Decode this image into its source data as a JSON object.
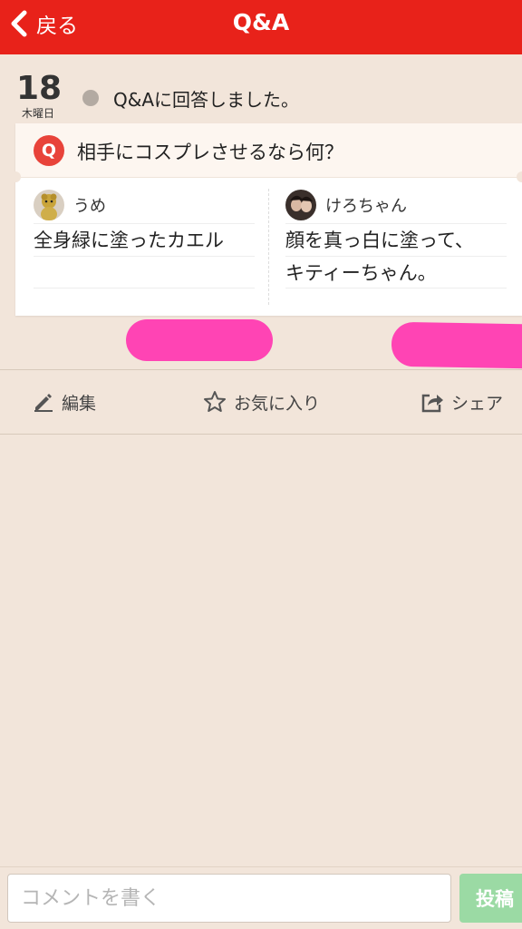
{
  "navbar": {
    "back_label": "戻る",
    "title": "Q&A"
  },
  "entry": {
    "day": "18",
    "weekday": "木曜日",
    "activity": "Q&Aに回答しました。"
  },
  "question": {
    "badge": "Q",
    "text": "相手にコスプレさせるなら何？"
  },
  "answers": [
    {
      "user": "うめ",
      "lines": [
        "全身緑に塗ったカエル",
        ""
      ]
    },
    {
      "user": "けろちゃん",
      "lines": [
        "顔を真っ白に塗って、",
        "キティーちゃん。"
      ]
    }
  ],
  "actions": {
    "edit": "編集",
    "favorite": "お気に入り",
    "share": "シェア"
  },
  "comment": {
    "placeholder": "コメントを書く",
    "post_label": "投稿"
  },
  "colors": {
    "navbar": "#e8221a",
    "background": "#f2e5da",
    "q_badge": "#e8433a",
    "post_button": "#9bdaa4",
    "redaction": "#ff44b4"
  },
  "icons": {
    "back": "chevron-left-icon",
    "edit": "pencil-icon",
    "favorite": "star-icon",
    "share": "share-icon"
  }
}
